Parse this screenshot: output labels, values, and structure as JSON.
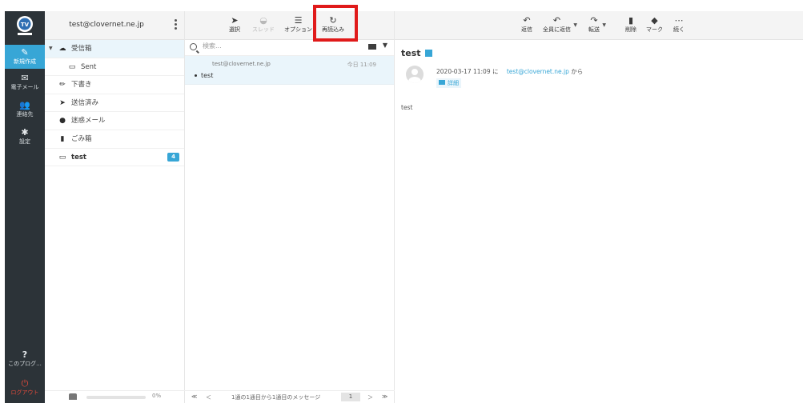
{
  "app": {
    "account_email": "test@clovernet.ne.jp",
    "accent_color": "#37a6d6"
  },
  "rail": {
    "logo_icon": "tv-logo-icon",
    "items": [
      {
        "label": "新規作成",
        "icon": "compose-icon",
        "active": true
      },
      {
        "label": "電子メール",
        "icon": "mail-icon",
        "active": false
      },
      {
        "label": "連絡先",
        "icon": "contacts-icon",
        "active": false
      },
      {
        "label": "設定",
        "icon": "gear-icon",
        "active": false
      }
    ],
    "help_label": "このプログ...",
    "logout_label": "ログアウト"
  },
  "folders": {
    "items": [
      {
        "label": "受信箱",
        "icon": "inbox-icon"
      },
      {
        "label": "Sent",
        "icon": "folder-icon"
      },
      {
        "label": "下書き",
        "icon": "pencil-icon"
      },
      {
        "label": "送信済み",
        "icon": "send-icon"
      },
      {
        "label": "迷惑メール",
        "icon": "fire-icon"
      },
      {
        "label": "ごみ箱",
        "icon": "trash-icon"
      },
      {
        "label": "test",
        "icon": "folder-icon",
        "badge": "4"
      }
    ],
    "quota_percent": "0%"
  },
  "list_toolbar": {
    "select_label": "選択",
    "thread_label": "スレッド",
    "options_label": "オプション",
    "reload_label": "再読込み"
  },
  "search": {
    "placeholder": "検索..."
  },
  "messages": [
    {
      "from": "test@clovernet.ne.jp",
      "date": "今日 11:09",
      "subject": "test"
    }
  ],
  "list_footer": {
    "first": "≪",
    "prev": "＜",
    "info": "1通の1通目から1通目のメッセージ",
    "page": "1",
    "next": "＞",
    "last": "≫"
  },
  "preview_toolbar": {
    "reply_label": "返信",
    "reply_all_label": "全員に返信",
    "forward_label": "転送",
    "delete_label": "削除",
    "mark_label": "マーク",
    "more_label": "続く"
  },
  "preview": {
    "subject": "test",
    "date": "2020-03-17 11:09 に",
    "from_address": "test@clovernet.ne.jp",
    "from_suffix": "から",
    "details_label": "詳細",
    "body": "test"
  }
}
